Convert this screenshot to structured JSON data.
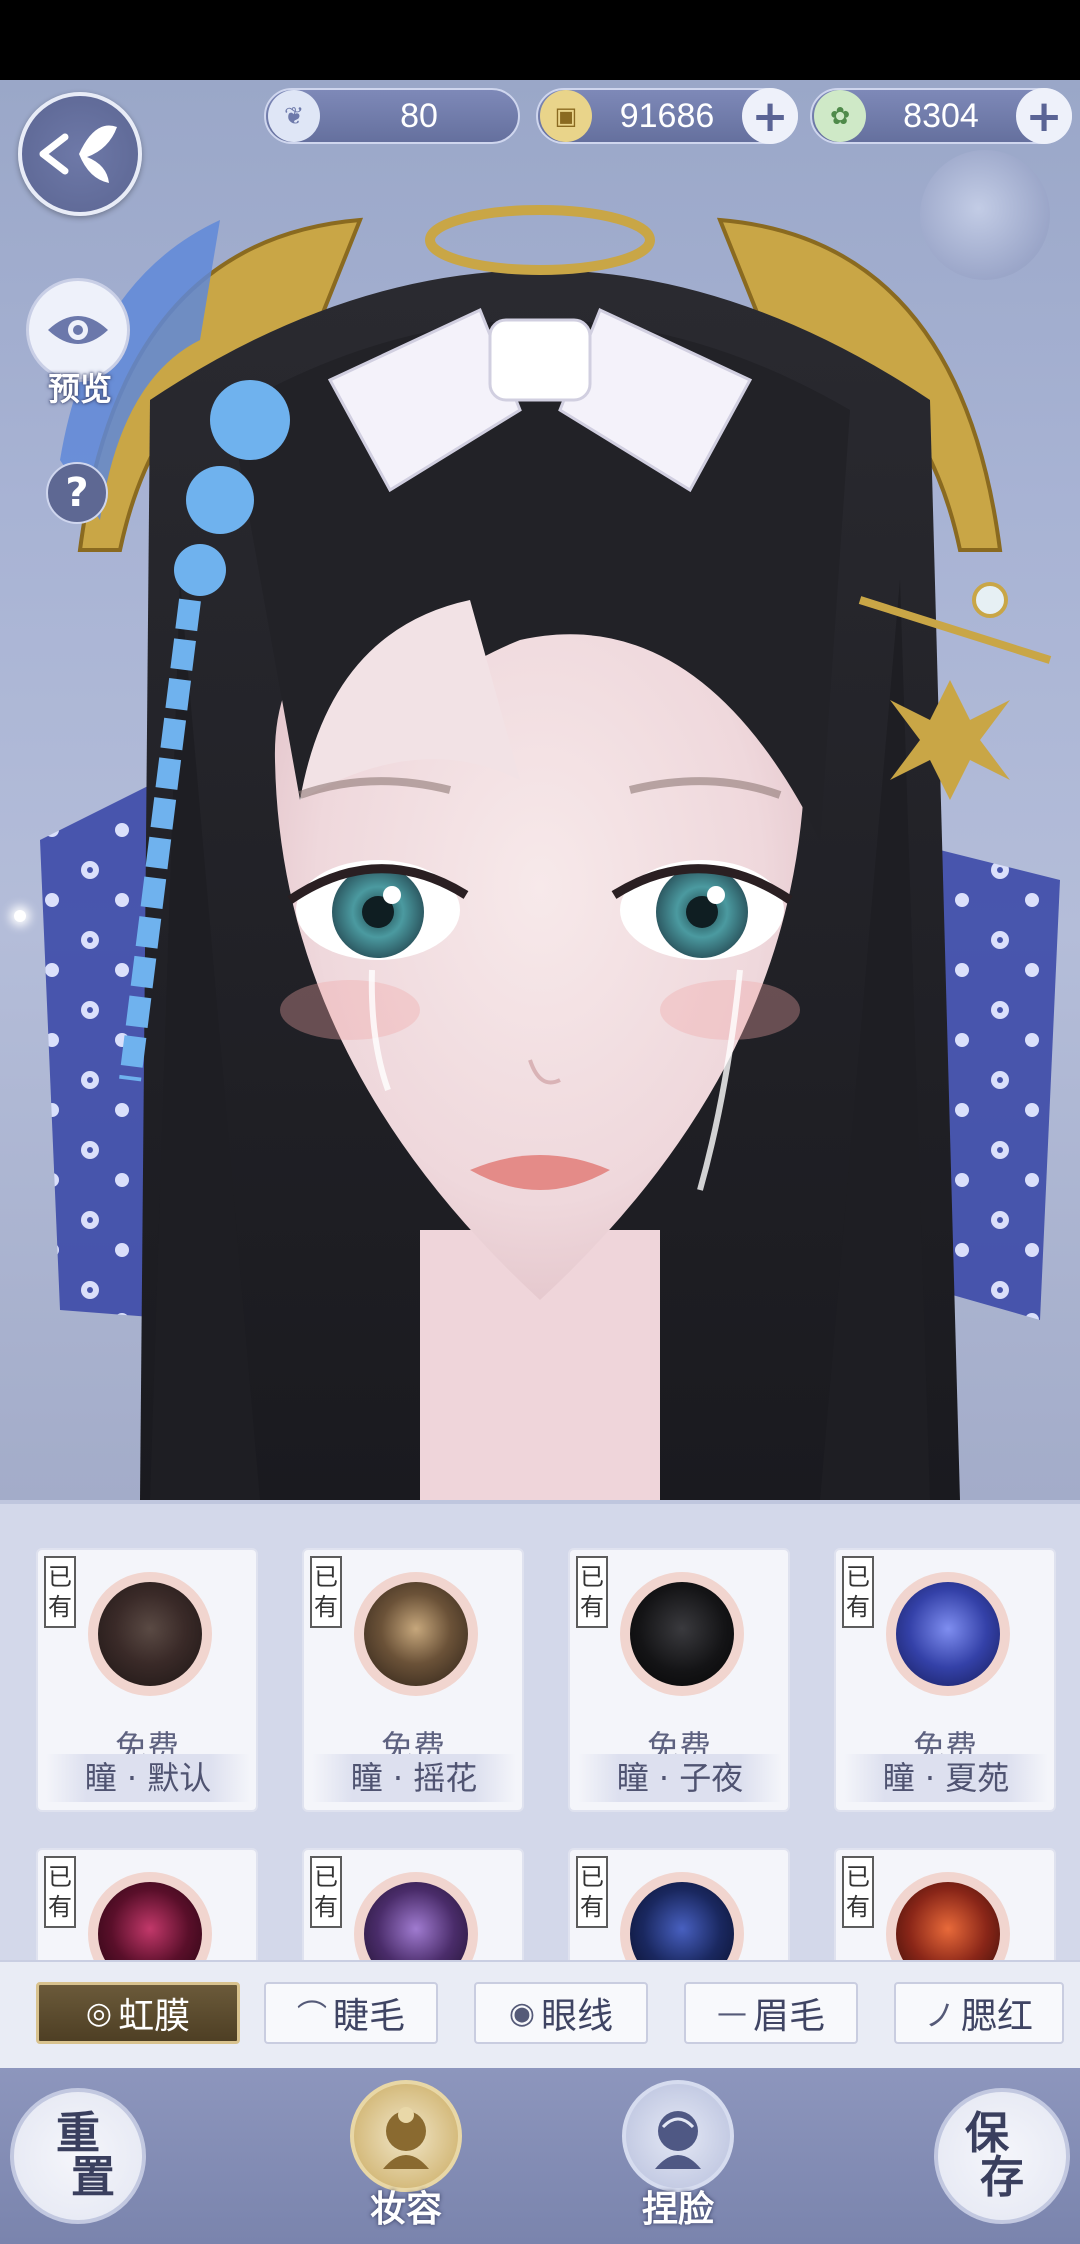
{
  "hud": {
    "currencies": [
      {
        "icon": "feather-coin-icon",
        "value": "80",
        "has_plus": false
      },
      {
        "icon": "gold-coin-icon",
        "value": "91686",
        "has_plus": true
      },
      {
        "icon": "jade-token-icon",
        "value": "8304",
        "has_plus": true
      }
    ],
    "preview_label": "预览",
    "help_label": "?"
  },
  "items": [
    {
      "owned": "已有",
      "price": "免费",
      "name": "瞳 · 默认",
      "color": "#3a2a28"
    },
    {
      "owned": "已有",
      "price": "免费",
      "name": "瞳 · 摇花",
      "color": "#6b5238"
    },
    {
      "owned": "已有",
      "price": "免费",
      "name": "瞳 · 子夜",
      "color": "#141416"
    },
    {
      "owned": "已有",
      "price": "免费",
      "name": "瞳 · 夏苑",
      "color": "#3441a8"
    },
    {
      "owned": "已有",
      "price": "",
      "name": "",
      "color": "#5a0f2a"
    },
    {
      "owned": "已有",
      "price": "",
      "name": "",
      "color": "#4a2c6a"
    },
    {
      "owned": "已有",
      "price": "",
      "name": "",
      "color": "#1a2860"
    },
    {
      "owned": "已有",
      "price": "",
      "name": "",
      "color": "#8a2618"
    }
  ],
  "tabs": [
    {
      "label": "虹膜",
      "icon": "◎",
      "active": true
    },
    {
      "label": "睫毛",
      "icon": "⌒",
      "active": false
    },
    {
      "label": "眼线",
      "icon": "◉",
      "active": false
    },
    {
      "label": "眉毛",
      "icon": "—",
      "active": false
    },
    {
      "label": "腮红",
      "icon": "ノ",
      "active": false
    }
  ],
  "nav": {
    "reset_line1": "重",
    "reset_line2": "置",
    "makeup_label": "妆容",
    "face_label": "捏脸",
    "save_line1": "保",
    "save_line2": "存"
  },
  "colors": {
    "accent_gold": "#d8c28e",
    "panel_bg": "#d3d8ea",
    "hud_bg": "#6e79a8"
  }
}
